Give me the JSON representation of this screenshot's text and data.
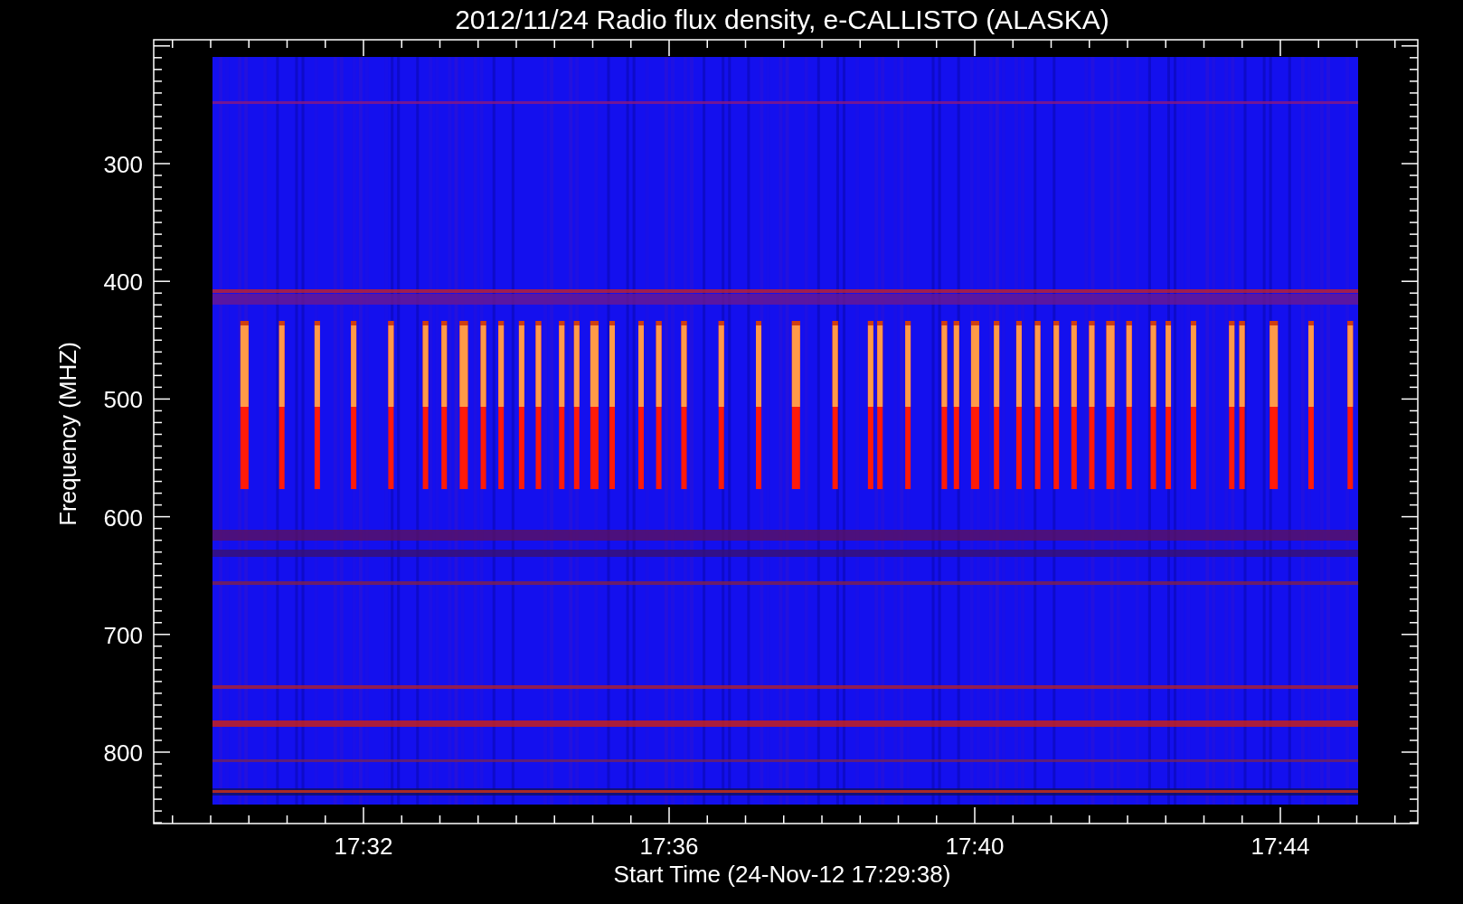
{
  "title": "2012/11/24  Radio flux density, e-CALLISTO (ALASKA)",
  "y_axis": {
    "label": "Frequency (MHZ)",
    "ticks": [
      "300",
      "400",
      "500",
      "600",
      "700",
      "800"
    ]
  },
  "x_axis": {
    "label": "Start Time (24-Nov-12 17:29:38)",
    "ticks": [
      "17:32",
      "17:36",
      "17:40",
      "17:44"
    ]
  }
}
